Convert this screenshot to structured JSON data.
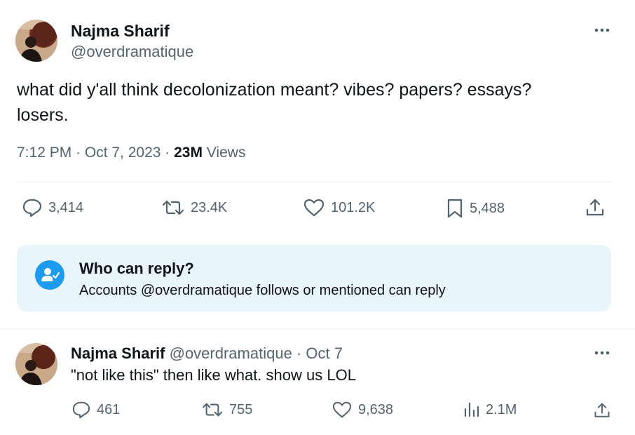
{
  "tweet": {
    "author_name": "Najma Sharif",
    "author_handle": "@overdramatique",
    "text_line1": "what did y'all think decolonization meant? vibes? papers? essays?",
    "text_line2": "losers.",
    "time": "7:12 PM · Oct 7, 2023 · ",
    "views_count": "23M",
    "views_label": " Views",
    "stats": {
      "replies": "3,414",
      "reposts": "23.4K",
      "likes": "101.2K",
      "bookmarks": "5,488"
    }
  },
  "reply_restriction": {
    "title": "Who can reply?",
    "description": "Accounts @overdramatique follows or mentioned can reply"
  },
  "reply": {
    "author_name": "Najma Sharif",
    "author_handle": " @overdramatique · Oct 7",
    "text": "\"not like this\" then like what. show us LOL",
    "stats": {
      "replies": "461",
      "reposts": "755",
      "likes": "9,638",
      "views": "2.1M"
    }
  },
  "icons": [
    "more-icon",
    "reply-icon",
    "repost-icon",
    "like-icon",
    "bookmark-icon",
    "share-icon",
    "views-icon",
    "who-can-reply-icon"
  ],
  "colors": {
    "text": "#0f1419",
    "secondary": "#536471",
    "accent": "#1d9bf0",
    "reply_box_bg": "#e8f5fd",
    "divider": "#eff3f4"
  }
}
